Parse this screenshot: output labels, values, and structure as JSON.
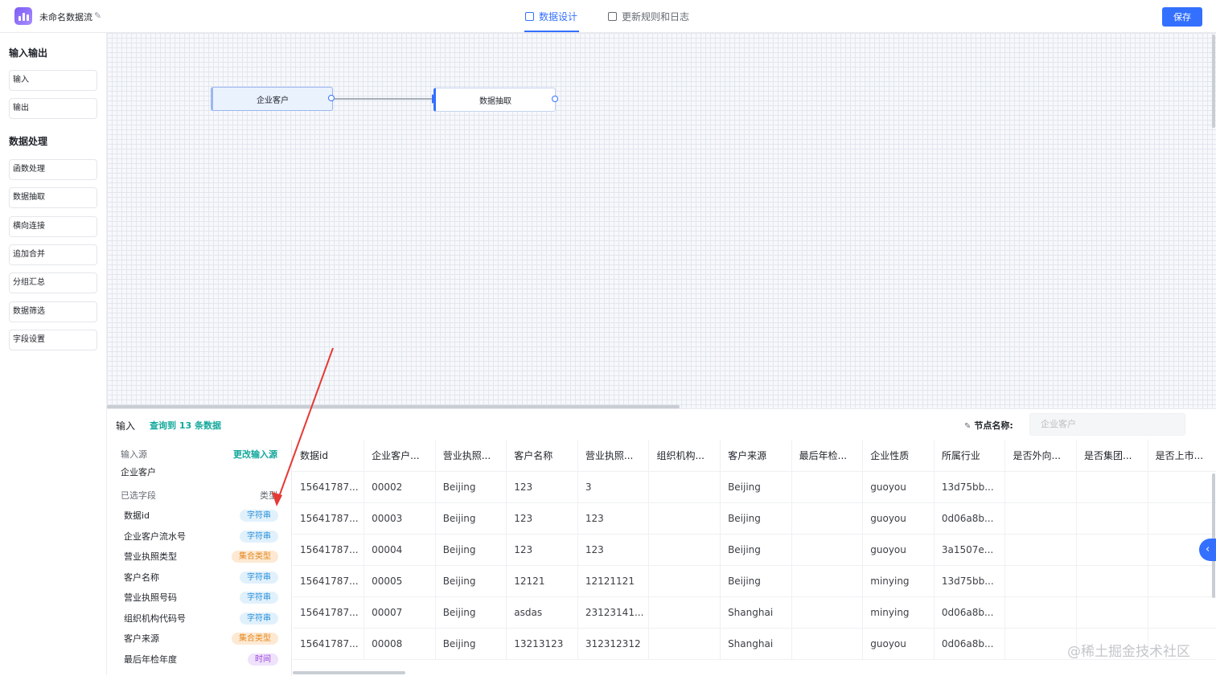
{
  "header": {
    "flow_title": "未命名数据流",
    "tabs": [
      "数据设计",
      "更新规则和日志"
    ],
    "save_label": "保存",
    "accent": "#3370ff"
  },
  "sidebar": {
    "groups": [
      {
        "title": "输入输出",
        "items": [
          "输入",
          "输出"
        ]
      },
      {
        "title": "数据处理",
        "items": [
          "函数处理",
          "数据抽取",
          "横向连接",
          "追加合并",
          "分组汇总",
          "数据筛选",
          "字段设置"
        ]
      }
    ]
  },
  "canvas": {
    "nodes": [
      {
        "label": "企业客户"
      },
      {
        "label": "数据抽取"
      }
    ]
  },
  "bottom": {
    "title": "输入",
    "count_text": "查询到 13 条数据",
    "node_name_label": "节点名称:",
    "node_name_placeholder": "企业客户",
    "source_label": "输入源",
    "change_source": "更改输入源",
    "source_value": "企业客户",
    "selected_fields_label": "已选字段",
    "type_label": "类型",
    "fields": [
      {
        "name": "数据id",
        "type": "字符串",
        "kind": "str"
      },
      {
        "name": "企业客户流水号",
        "type": "字符串",
        "kind": "str"
      },
      {
        "name": "营业执照类型",
        "type": "集合类型",
        "kind": "set"
      },
      {
        "name": "客户名称",
        "type": "字符串",
        "kind": "str"
      },
      {
        "name": "营业执照号码",
        "type": "字符串",
        "kind": "str"
      },
      {
        "name": "组织机构代码号",
        "type": "字符串",
        "kind": "str"
      },
      {
        "name": "客户来源",
        "type": "集合类型",
        "kind": "set"
      },
      {
        "name": "最后年检年度",
        "type": "时间",
        "kind": "time"
      }
    ],
    "table": {
      "columns": [
        "数据id",
        "企业客户...",
        "营业执照...",
        "客户名称",
        "营业执照...",
        "组织机构...",
        "客户来源",
        "最后年检...",
        "企业性质",
        "所属行业",
        "是否外向...",
        "是否集团...",
        "是否上市..."
      ],
      "rows": [
        [
          "15641787...",
          "00002",
          "Beijing",
          "123",
          "3",
          "",
          "Beijing",
          "",
          "guoyou",
          "13d75bb...",
          "",
          "",
          ""
        ],
        [
          "15641787...",
          "00003",
          "Beijing",
          "123",
          "123",
          "",
          "Beijing",
          "",
          "guoyou",
          "0d06a8b...",
          "",
          "",
          ""
        ],
        [
          "15641787...",
          "00004",
          "Beijing",
          "123",
          "123",
          "",
          "Beijing",
          "",
          "guoyou",
          "3a1507e...",
          "",
          "",
          ""
        ],
        [
          "15641787...",
          "00005",
          "Beijing",
          "12121",
          "12121121",
          "",
          "Beijing",
          "",
          "minying",
          "13d75bb...",
          "",
          "",
          ""
        ],
        [
          "15641787...",
          "00007",
          "Beijing",
          "asdas",
          "23123141...",
          "",
          "Shanghai",
          "",
          "minying",
          "0d06a8b...",
          "",
          "",
          ""
        ],
        [
          "15641787...",
          "00008",
          "Beijing",
          "13213123",
          "312312312",
          "",
          "Shanghai",
          "",
          "guoyou",
          "0d06a8b...",
          "",
          "",
          ""
        ]
      ]
    }
  },
  "watermark": "@稀土掘金技术社区"
}
